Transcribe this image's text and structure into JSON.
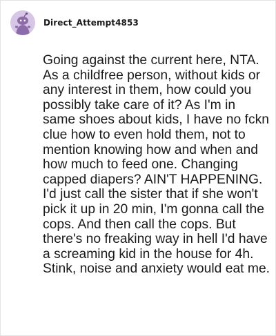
{
  "comment": {
    "author": "Direct_Attempt4853",
    "avatar_icon": "snoo-avatar-icon",
    "avatar_color": "#d8c6e6",
    "body": "Going against the current here, NTA. As a childfree person, without kids or any interest in them, how could you possibly take care of it? As I'm in same shoes about kids, I have no fckn clue how to even hold them, not to mention knowing how and when and how much to feed one. Changing capped diapers? AIN'T HAPPENING. I'd just call the sister that if she won't pick it up in 20 min, I'm gonna call the cops. And then call the cops. But there's no freaking way in hell I'd have a screaming kid in the house for 4h. Stink, noise and anxiety would eat me."
  }
}
